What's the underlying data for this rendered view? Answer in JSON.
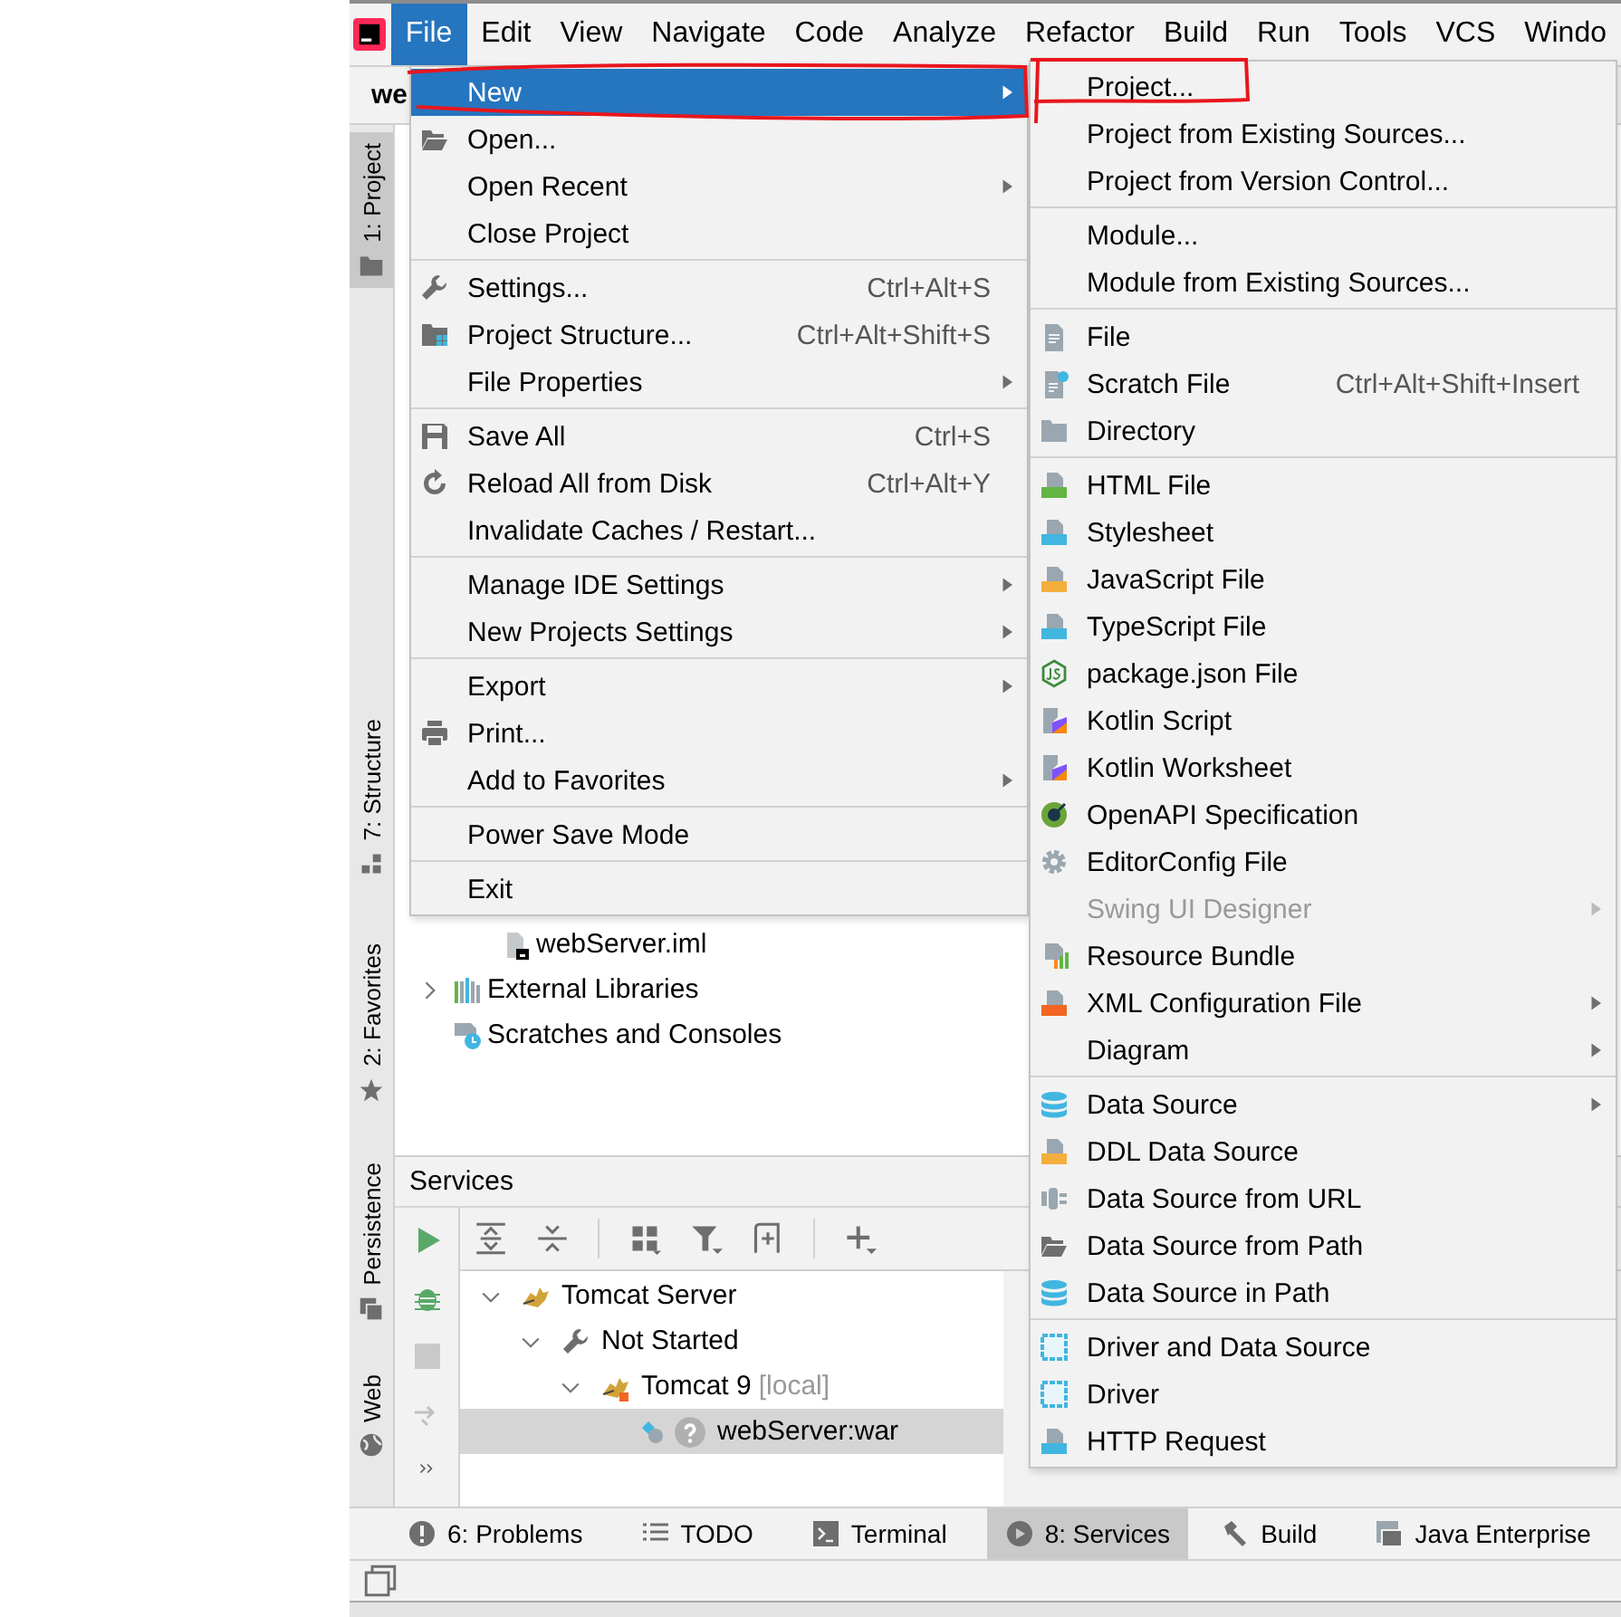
{
  "menu_bar": [
    {
      "label": "File",
      "selected": true
    },
    {
      "label": "Edit",
      "selected": false
    },
    {
      "label": "View",
      "selected": false
    },
    {
      "label": "Navigate",
      "selected": false
    },
    {
      "label": "Code",
      "selected": false
    },
    {
      "label": "Analyze",
      "selected": false
    },
    {
      "label": "Refactor",
      "selected": false
    },
    {
      "label": "Build",
      "selected": false
    },
    {
      "label": "Run",
      "selected": false
    },
    {
      "label": "Tools",
      "selected": false
    },
    {
      "label": "VCS",
      "selected": false
    },
    {
      "label": "Windo",
      "selected": false
    }
  ],
  "navigation_bar": {
    "path": "we"
  },
  "tool_strip": [
    {
      "label": "1: Project",
      "selected": true
    },
    {
      "label": "7: Structure",
      "selected": false
    },
    {
      "label": "2: Favorites",
      "selected": false
    },
    {
      "label": "Persistence",
      "selected": false
    },
    {
      "label": "Web",
      "selected": false
    }
  ],
  "project_tree": [
    {
      "label": "webServer.iml"
    },
    {
      "label": "External Libraries",
      "expanded": false
    },
    {
      "label": "Scratches and Consoles"
    }
  ],
  "services": {
    "title": "Services",
    "tree": [
      {
        "label": "Tomcat Server",
        "expanded": true,
        "selected": false,
        "children": [
          {
            "label": "Not Started",
            "expanded": true,
            "selected": false,
            "children": [
              {
                "label": "Tomcat 9",
                "tag": "[local]",
                "expanded": true,
                "selected": false,
                "children": [
                  {
                    "label": "webServer:war",
                    "selected": true
                  }
                ]
              }
            ]
          }
        ]
      }
    ]
  },
  "bottom_tabs": [
    {
      "label": "6: Problems",
      "selected": false
    },
    {
      "label": "TODO",
      "selected": false
    },
    {
      "label": "Terminal",
      "selected": false
    },
    {
      "label": "8: Services",
      "selected": true
    },
    {
      "label": "Build",
      "selected": false
    },
    {
      "label": "Java Enterprise",
      "selected": false
    }
  ],
  "file_menu": {
    "groups": [
      [
        {
          "label": "New",
          "submenu": true,
          "selected": true
        },
        {
          "label": "Open...",
          "submenu": false,
          "selected": false
        },
        {
          "label": "Open Recent",
          "submenu": true,
          "selected": false
        },
        {
          "label": "Close Project",
          "submenu": false,
          "selected": false
        }
      ],
      [
        {
          "label": "Settings...",
          "shortcut": "Ctrl+Alt+S",
          "submenu": false,
          "selected": false
        },
        {
          "label": "Project Structure...",
          "shortcut": "Ctrl+Alt+Shift+S",
          "submenu": false,
          "selected": false
        },
        {
          "label": "File Properties",
          "submenu": true,
          "selected": false
        }
      ],
      [
        {
          "label": "Save All",
          "shortcut": "Ctrl+S",
          "submenu": false,
          "selected": false
        },
        {
          "label": "Reload All from Disk",
          "shortcut": "Ctrl+Alt+Y",
          "submenu": false,
          "selected": false
        },
        {
          "label": "Invalidate Caches / Restart...",
          "submenu": false,
          "selected": false
        }
      ],
      [
        {
          "label": "Manage IDE Settings",
          "submenu": true,
          "selected": false
        },
        {
          "label": "New Projects Settings",
          "submenu": true,
          "selected": false
        }
      ],
      [
        {
          "label": "Export",
          "submenu": true,
          "selected": false
        },
        {
          "label": "Print...",
          "submenu": false,
          "selected": false
        },
        {
          "label": "Add to Favorites",
          "submenu": true,
          "selected": false
        }
      ],
      [
        {
          "label": "Power Save Mode",
          "submenu": false,
          "selected": false
        }
      ],
      [
        {
          "label": "Exit",
          "submenu": false,
          "selected": false
        }
      ]
    ]
  },
  "new_submenu": {
    "groups": [
      [
        {
          "label": "Project...",
          "submenu": false,
          "disabled": false
        },
        {
          "label": "Project from Existing Sources...",
          "submenu": false,
          "disabled": false
        },
        {
          "label": "Project from Version Control...",
          "submenu": false,
          "disabled": false
        }
      ],
      [
        {
          "label": "Module...",
          "submenu": false,
          "disabled": false
        },
        {
          "label": "Module from Existing Sources...",
          "submenu": false,
          "disabled": false
        }
      ],
      [
        {
          "label": "File",
          "submenu": false,
          "disabled": false
        },
        {
          "label": "Scratch File",
          "shortcut": "Ctrl+Alt+Shift+Insert",
          "submenu": false,
          "disabled": false
        },
        {
          "label": "Directory",
          "submenu": false,
          "disabled": false
        }
      ],
      [
        {
          "label": "HTML File",
          "submenu": false,
          "disabled": false
        },
        {
          "label": "Stylesheet",
          "submenu": false,
          "disabled": false
        },
        {
          "label": "JavaScript File",
          "submenu": false,
          "disabled": false
        },
        {
          "label": "TypeScript File",
          "submenu": false,
          "disabled": false
        },
        {
          "label": "package.json File",
          "submenu": false,
          "disabled": false
        },
        {
          "label": "Kotlin Script",
          "submenu": false,
          "disabled": false
        },
        {
          "label": "Kotlin Worksheet",
          "submenu": false,
          "disabled": false
        },
        {
          "label": "OpenAPI Specification",
          "submenu": false,
          "disabled": false
        },
        {
          "label": "EditorConfig File",
          "submenu": false,
          "disabled": false
        },
        {
          "label": "Swing UI Designer",
          "submenu": true,
          "disabled": true
        },
        {
          "label": "Resource Bundle",
          "submenu": false,
          "disabled": false
        },
        {
          "label": "XML Configuration File",
          "submenu": true,
          "disabled": false
        },
        {
          "label": "Diagram",
          "submenu": true,
          "disabled": false
        }
      ],
      [
        {
          "label": "Data Source",
          "submenu": true,
          "disabled": false
        },
        {
          "label": "DDL Data Source",
          "submenu": false,
          "disabled": false
        },
        {
          "label": "Data Source from URL",
          "submenu": false,
          "disabled": false
        },
        {
          "label": "Data Source from Path",
          "submenu": false,
          "disabled": false
        },
        {
          "label": "Data Source in Path",
          "submenu": false,
          "disabled": false
        }
      ],
      [
        {
          "label": "Driver and Data Source",
          "submenu": false,
          "disabled": false
        },
        {
          "label": "Driver",
          "submenu": false,
          "disabled": false
        },
        {
          "label": "HTTP Request",
          "submenu": false,
          "disabled": false
        }
      ]
    ]
  }
}
